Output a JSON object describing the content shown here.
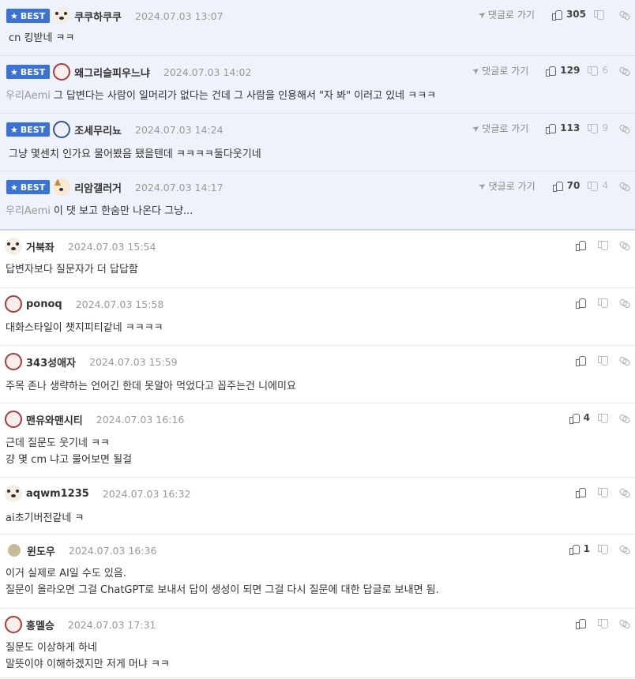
{
  "labels": {
    "best": "BEST",
    "reply_link": "댓글로 가기"
  },
  "best_comments": [
    {
      "nick": "쿠쿠하쿠쿠",
      "date": "2024.07.03 13:07",
      "up": "305",
      "down": "",
      "quote": "",
      "text": "cn 킹받네 ㅋㅋ",
      "avatar": "dog"
    },
    {
      "nick": "왜그리슬피우느냐",
      "date": "2024.07.03 14:02",
      "up": "129",
      "down": "6",
      "quote": "우리Aemi",
      "text": "그 답변다는 사람이 일머리가 없다는 건데 그 사람을 인용해서 \"자 봐\" 이러고 있네 ㅋㅋㅋ",
      "avatar": "red"
    },
    {
      "nick": "조세무리뇨",
      "date": "2024.07.03 14:24",
      "up": "113",
      "down": "9",
      "quote": "",
      "text": "그냥 몇센치 인가요 물어봤음 됐을텐데 ㅋㅋㅋㅋ둘다웃기네",
      "avatar": "blue"
    },
    {
      "nick": "리암갤러거",
      "date": "2024.07.03 14:17",
      "up": "70",
      "down": "4",
      "quote": "우리Aemi",
      "text": "이 댓 보고 한숨만 나온다 그냥...",
      "avatar": "fox"
    }
  ],
  "comments": [
    {
      "nick": "거북좌",
      "date": "2024.07.03 15:54",
      "up": "",
      "lines": [
        "답변자보다 질문자가 더 답답함"
      ],
      "avatar": "dog"
    },
    {
      "nick": "ponoq",
      "date": "2024.07.03 15:58",
      "up": "",
      "lines": [
        "대화스타일이 챗지피티같네 ㅋㅋㅋㅋ"
      ],
      "avatar": "red"
    },
    {
      "nick": "343성애자",
      "date": "2024.07.03 15:59",
      "up": "",
      "lines": [
        "주목 존나 생략하는 언어긴 한데 못알아 먹었다고 꼽주는건 니에미요"
      ],
      "avatar": "red"
    },
    {
      "nick": "맨유와맨시티",
      "date": "2024.07.03 16:16",
      "up": "4",
      "lines": [
        "근데 질문도 웃기네 ㅋㅋ",
        "걍 몇 cm 냐고 물어보면 될걸"
      ],
      "avatar": "red"
    },
    {
      "nick": "aqwm1235",
      "date": "2024.07.03 16:32",
      "up": "",
      "lines": [
        "ai초기버전같네 ㅋ"
      ],
      "avatar": "dog"
    },
    {
      "nick": "윈도우",
      "date": "2024.07.03 16:36",
      "up": "1",
      "lines": [
        "이거 실제로 AI일 수도 있음.",
        "질문이 올라오면 그걸 ChatGPT로 보내서 답이 생성이 되면 그걸 다시 질문에 대한 답글로 보내면 됨."
      ],
      "avatar": "plain"
    },
    {
      "nick": "홍멜승",
      "date": "2024.07.03 17:31",
      "up": "",
      "lines": [
        "질문도 이상하게 하네",
        "말뜻이야 이해하겠지만 저게 머냐 ㅋㅋ"
      ],
      "avatar": "red"
    }
  ]
}
